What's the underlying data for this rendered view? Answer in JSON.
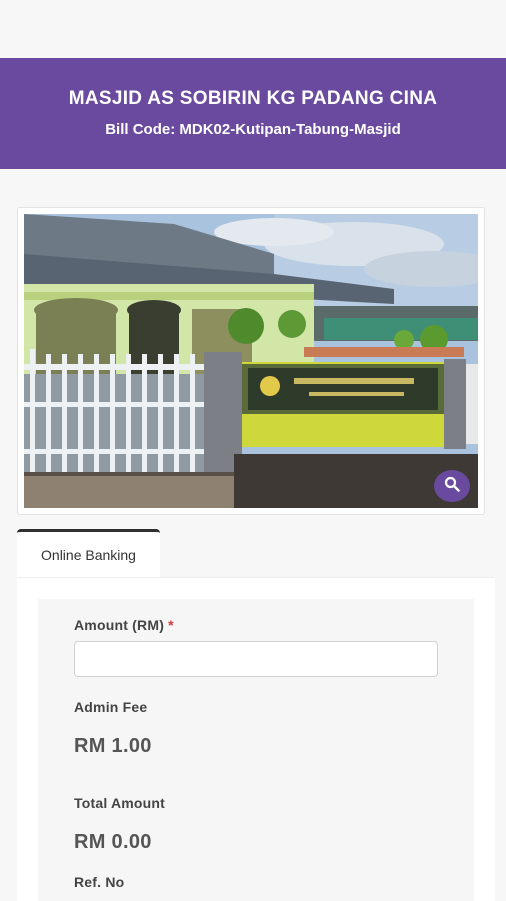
{
  "header": {
    "title": "MASJID AS SOBIRIN KG PADANG CINA",
    "bill_code": "Bill Code: MDK02-Kutipan-Tabung-Masjid"
  },
  "photo": {
    "zoom_icon": "magnifier-icon"
  },
  "tabs": [
    {
      "label": "Online Banking"
    }
  ],
  "form": {
    "amount_label": "Amount (RM)",
    "required_mark": "*",
    "amount_value": "",
    "admin_fee_label": "Admin Fee",
    "admin_fee_value": "RM 1.00",
    "total_label": "Total Amount",
    "total_value": "RM 0.00",
    "ref_label": "Ref. No"
  },
  "colors": {
    "brand": "#6a4a9f",
    "required": "#d9363e"
  }
}
